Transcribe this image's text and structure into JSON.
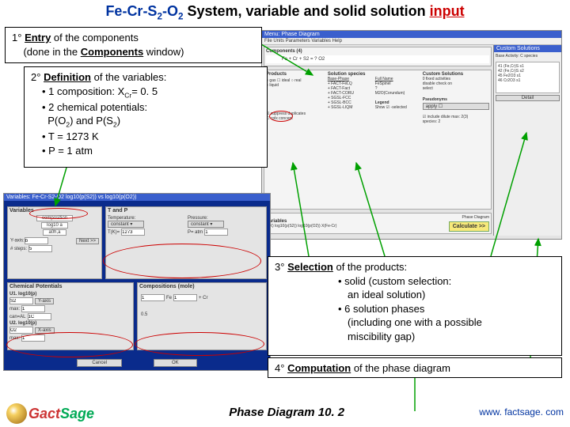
{
  "title": {
    "pre": "Fe-Cr-S",
    "sub1": "2",
    "mid": "-O",
    "sub2": "2",
    "post": " System, variable  and solid solution ",
    "red": "input"
  },
  "callouts": {
    "c1": {
      "step": "1°",
      "l1a": "Entry",
      "l1b": " of the components",
      "l2a": "(done in the ",
      "l2b": "Components",
      "l2c": " window)"
    },
    "c2": {
      "step": "2°",
      "l1a": "Definition",
      "l1b": " of the variables:",
      "b1": "• 1 composition: X",
      "b1sub": "Cr",
      "b1tail": "= 0. 5",
      "b2": "• 2 chemical potentials:",
      "b2b": "P(O",
      "b2bsub": "2",
      "b2bmid": ") and P(S",
      "b2bsub2": "2",
      "b2btail": ")",
      "b3": "• T = 1273 K",
      "b4": "• P = 1 atm"
    },
    "c3": {
      "step": "3°",
      "l1a": "Selection",
      "l1b": " of the products:",
      "b1": "• solid (custom selection:",
      "b1b": "an ideal solution)",
      "b2": "• 6 solution phases",
      "b2b": "(including one with a possible",
      "b2c": "miscibility gap)"
    },
    "c4": {
      "step": "4°",
      "l1a": "Computation",
      "l1b": " of the phase diagram"
    }
  },
  "phasewin": {
    "title": "Menu: Phase Diagram",
    "menu": "File  Units  Parameters  Variables  Help",
    "components": "Components (4)",
    "comprow": "Fe + Cr + S2 = ? O2",
    "products": "Products",
    "solspecies": "Solution species",
    "basephase": "Base-Phase",
    "fullname": "Full Name",
    "phases": [
      "FACT-FeLQ",
      "FACT-Fact",
      "FACT-CORU",
      "SGSL-FCC",
      "SGSL-BCC",
      "SGSL-LIQM"
    ],
    "custom": "Custom Solutions",
    "customlbl": "0 fixed activities\ndisable check on\nselect",
    "pseudo": "Pseudonyms",
    "legend": "Legend",
    "showsel": "Show ☑  -selected",
    "vars": "Variables",
    "varrow": "T(K)   log10(p(S2))   log10(p(O2))   X(Fe-Cr)",
    "calc": "Calculate >>",
    "sidebartitle": "Custom Solutions",
    "sidesub": "Base Activity: C species"
  },
  "varwin": {
    "title": "Variables: Fe-Cr-S2-O2  log10(p(S2)) vs log10(p(O2))",
    "vars": "Variables",
    "tp": "T and P",
    "compos": "composition",
    "logO2": "log10 a",
    "a0ha": "a0h,a",
    "next": "Next >>",
    "steps": "# steps:",
    "chem": "Chemical Potentials",
    "comp": "Compositions (mole)",
    "U1": "U1. log10(p)",
    "U2": "U2. log10(p)",
    "yaxis": "Y-axis",
    "xaxis": "X-axis",
    "cancel": "Cancel",
    "ok": "OK",
    "fe": "Fe",
    "cr": "+ Cr",
    "val05": "0.5",
    "tval": "1273",
    "pval": "1"
  },
  "footer": {
    "center": "Phase Diagram  10. 2",
    "url": "www. factsage. com"
  }
}
